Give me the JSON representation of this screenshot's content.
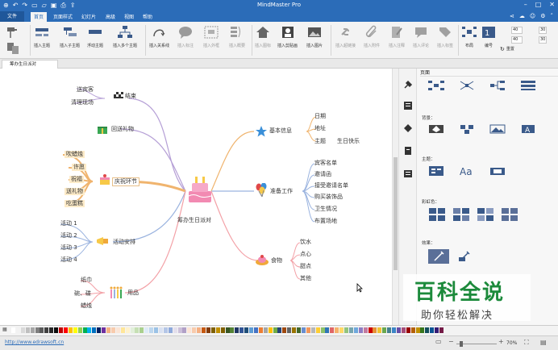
{
  "app": {
    "title": "MindMaster Pro"
  },
  "menu": {
    "file": "文件",
    "items": [
      "首页",
      "页面样式",
      "幻灯片",
      "高级",
      "视图",
      "帮助"
    ]
  },
  "ribbon": {
    "buttons": [
      {
        "label": "插入主题",
        "enabled": true
      },
      {
        "label": "插入子主题",
        "enabled": true
      },
      {
        "label": "浮动主题",
        "enabled": true
      },
      {
        "label": "插入多个主题",
        "enabled": true
      },
      {
        "label": "插入关系线",
        "enabled": true
      },
      {
        "label": "插入标注",
        "enabled": false
      },
      {
        "label": "插入外框",
        "enabled": false
      },
      {
        "label": "插入概要",
        "enabled": false
      },
      {
        "label": "插入图标",
        "enabled": false
      },
      {
        "label": "插入剪贴画",
        "enabled": true
      },
      {
        "label": "插入图片",
        "enabled": true
      },
      {
        "label": "插入超链接",
        "enabled": false
      },
      {
        "label": "插入附件",
        "enabled": false
      },
      {
        "label": "插入注释",
        "enabled": false
      },
      {
        "label": "插入评论",
        "enabled": false
      },
      {
        "label": "插入标签",
        "enabled": false
      },
      {
        "label": "布局",
        "enabled": true
      },
      {
        "label": "编号",
        "enabled": true
      },
      {
        "label": "重置",
        "enabled": true
      }
    ],
    "spin_values": [
      "40",
      "40",
      "30",
      "30"
    ]
  },
  "document": {
    "tab_label": "筹办生日派对"
  },
  "mindmap": {
    "central": "筹办生日派对",
    "branches": [
      {
        "label": "结束",
        "children": [
          "送宾客",
          "清理现场"
        ],
        "color": "#b59fd6"
      },
      {
        "label": "回送礼物",
        "children": [],
        "color": "#b59fd6"
      },
      {
        "label": "庆祝环节",
        "children": [
          "吹蜡烛",
          "许愿",
          "祝福",
          "送礼物",
          "吃蛋糕"
        ],
        "color": "#f0b46e"
      },
      {
        "label": "活动安排",
        "children": [
          "活动 1",
          "活动 2",
          "活动 3",
          "活动 4"
        ],
        "color": "#9ab3df"
      },
      {
        "label": "用品",
        "children": [
          "纸巾",
          "碗、碟",
          "蜡烛"
        ],
        "color": "#f3a0a6"
      },
      {
        "label": "基本信息",
        "children": [
          "日期",
          "地址",
          "主题"
        ],
        "color": "#f0b46e"
      },
      {
        "label": "准备工作",
        "children": [
          "宾客名单",
          "邀请函",
          "接受邀请名单",
          "购买装饰品",
          "卫生情况",
          "布置场地"
        ],
        "color": "#9ab3df"
      },
      {
        "label": "食物",
        "children": [
          "饮水",
          "点心",
          "甜点",
          "其他"
        ],
        "color": "#f3a0a6"
      }
    ],
    "extra": "生日快乐"
  },
  "panel": {
    "title": "页面",
    "sections": {
      "background": "背景：",
      "theme": "主题：",
      "rainbow": "彩虹色：",
      "effect": "效果："
    }
  },
  "status": {
    "url": "http://www.edrawsoft.cn",
    "zoom": "70%"
  },
  "watermark": {
    "big": "百科全说",
    "small": "助你轻松解决"
  },
  "colors": {
    "accent": "#2b6cb8",
    "palette": [
      "#ffffff",
      "#f2f2f2",
      "#d9d9d9",
      "#bfbfbf",
      "#a6a6a6",
      "#7f7f7f",
      "#595959",
      "#404040",
      "#262626",
      "#0d0d0d",
      "#c00000",
      "#ff0000",
      "#ffc000",
      "#ffff00",
      "#92d050",
      "#00b050",
      "#00b0f0",
      "#0070c0",
      "#002060",
      "#7030a0",
      "#f4b183",
      "#f8cbad",
      "#fbe5d6",
      "#ffe699",
      "#fff2cc",
      "#e2efda",
      "#c6e0b4",
      "#a9d08e",
      "#ddebf7",
      "#bdd7ee",
      "#9bc2e6",
      "#d9e1f2",
      "#b4c6e7",
      "#8ea9db",
      "#e4dfec",
      "#ccc0da",
      "#b1a0c7",
      "#fce4d6",
      "#f8cbad",
      "#f4b084",
      "#c65911",
      "#833c0b",
      "#7f6000",
      "#bf8f00",
      "#806000",
      "#375623",
      "#548235",
      "#203764",
      "#305496",
      "#1f4e78",
      "#5b9bd5",
      "#4472c4",
      "#ed7d31",
      "#a5a5a5",
      "#ffc000",
      "#70ad47",
      "#264478",
      "#9e480e",
      "#636363",
      "#997300",
      "#43682b",
      "#698ed0",
      "#f1975a",
      "#b7b7b7",
      "#ffcd33",
      "#8cc168",
      "#2e75b6",
      "#e06666",
      "#f6b26b",
      "#ffd966",
      "#93c47d",
      "#76a5af",
      "#6fa8dc",
      "#8e7cc3",
      "#c27ba0",
      "#cc0000",
      "#e69138",
      "#f1c232",
      "#6aa84f",
      "#45818e",
      "#3d85c6",
      "#674ea7",
      "#a64d79",
      "#990000",
      "#b45f06",
      "#bf9000",
      "#38761d",
      "#134f5c",
      "#0b5394",
      "#351c75",
      "#741b47"
    ]
  }
}
